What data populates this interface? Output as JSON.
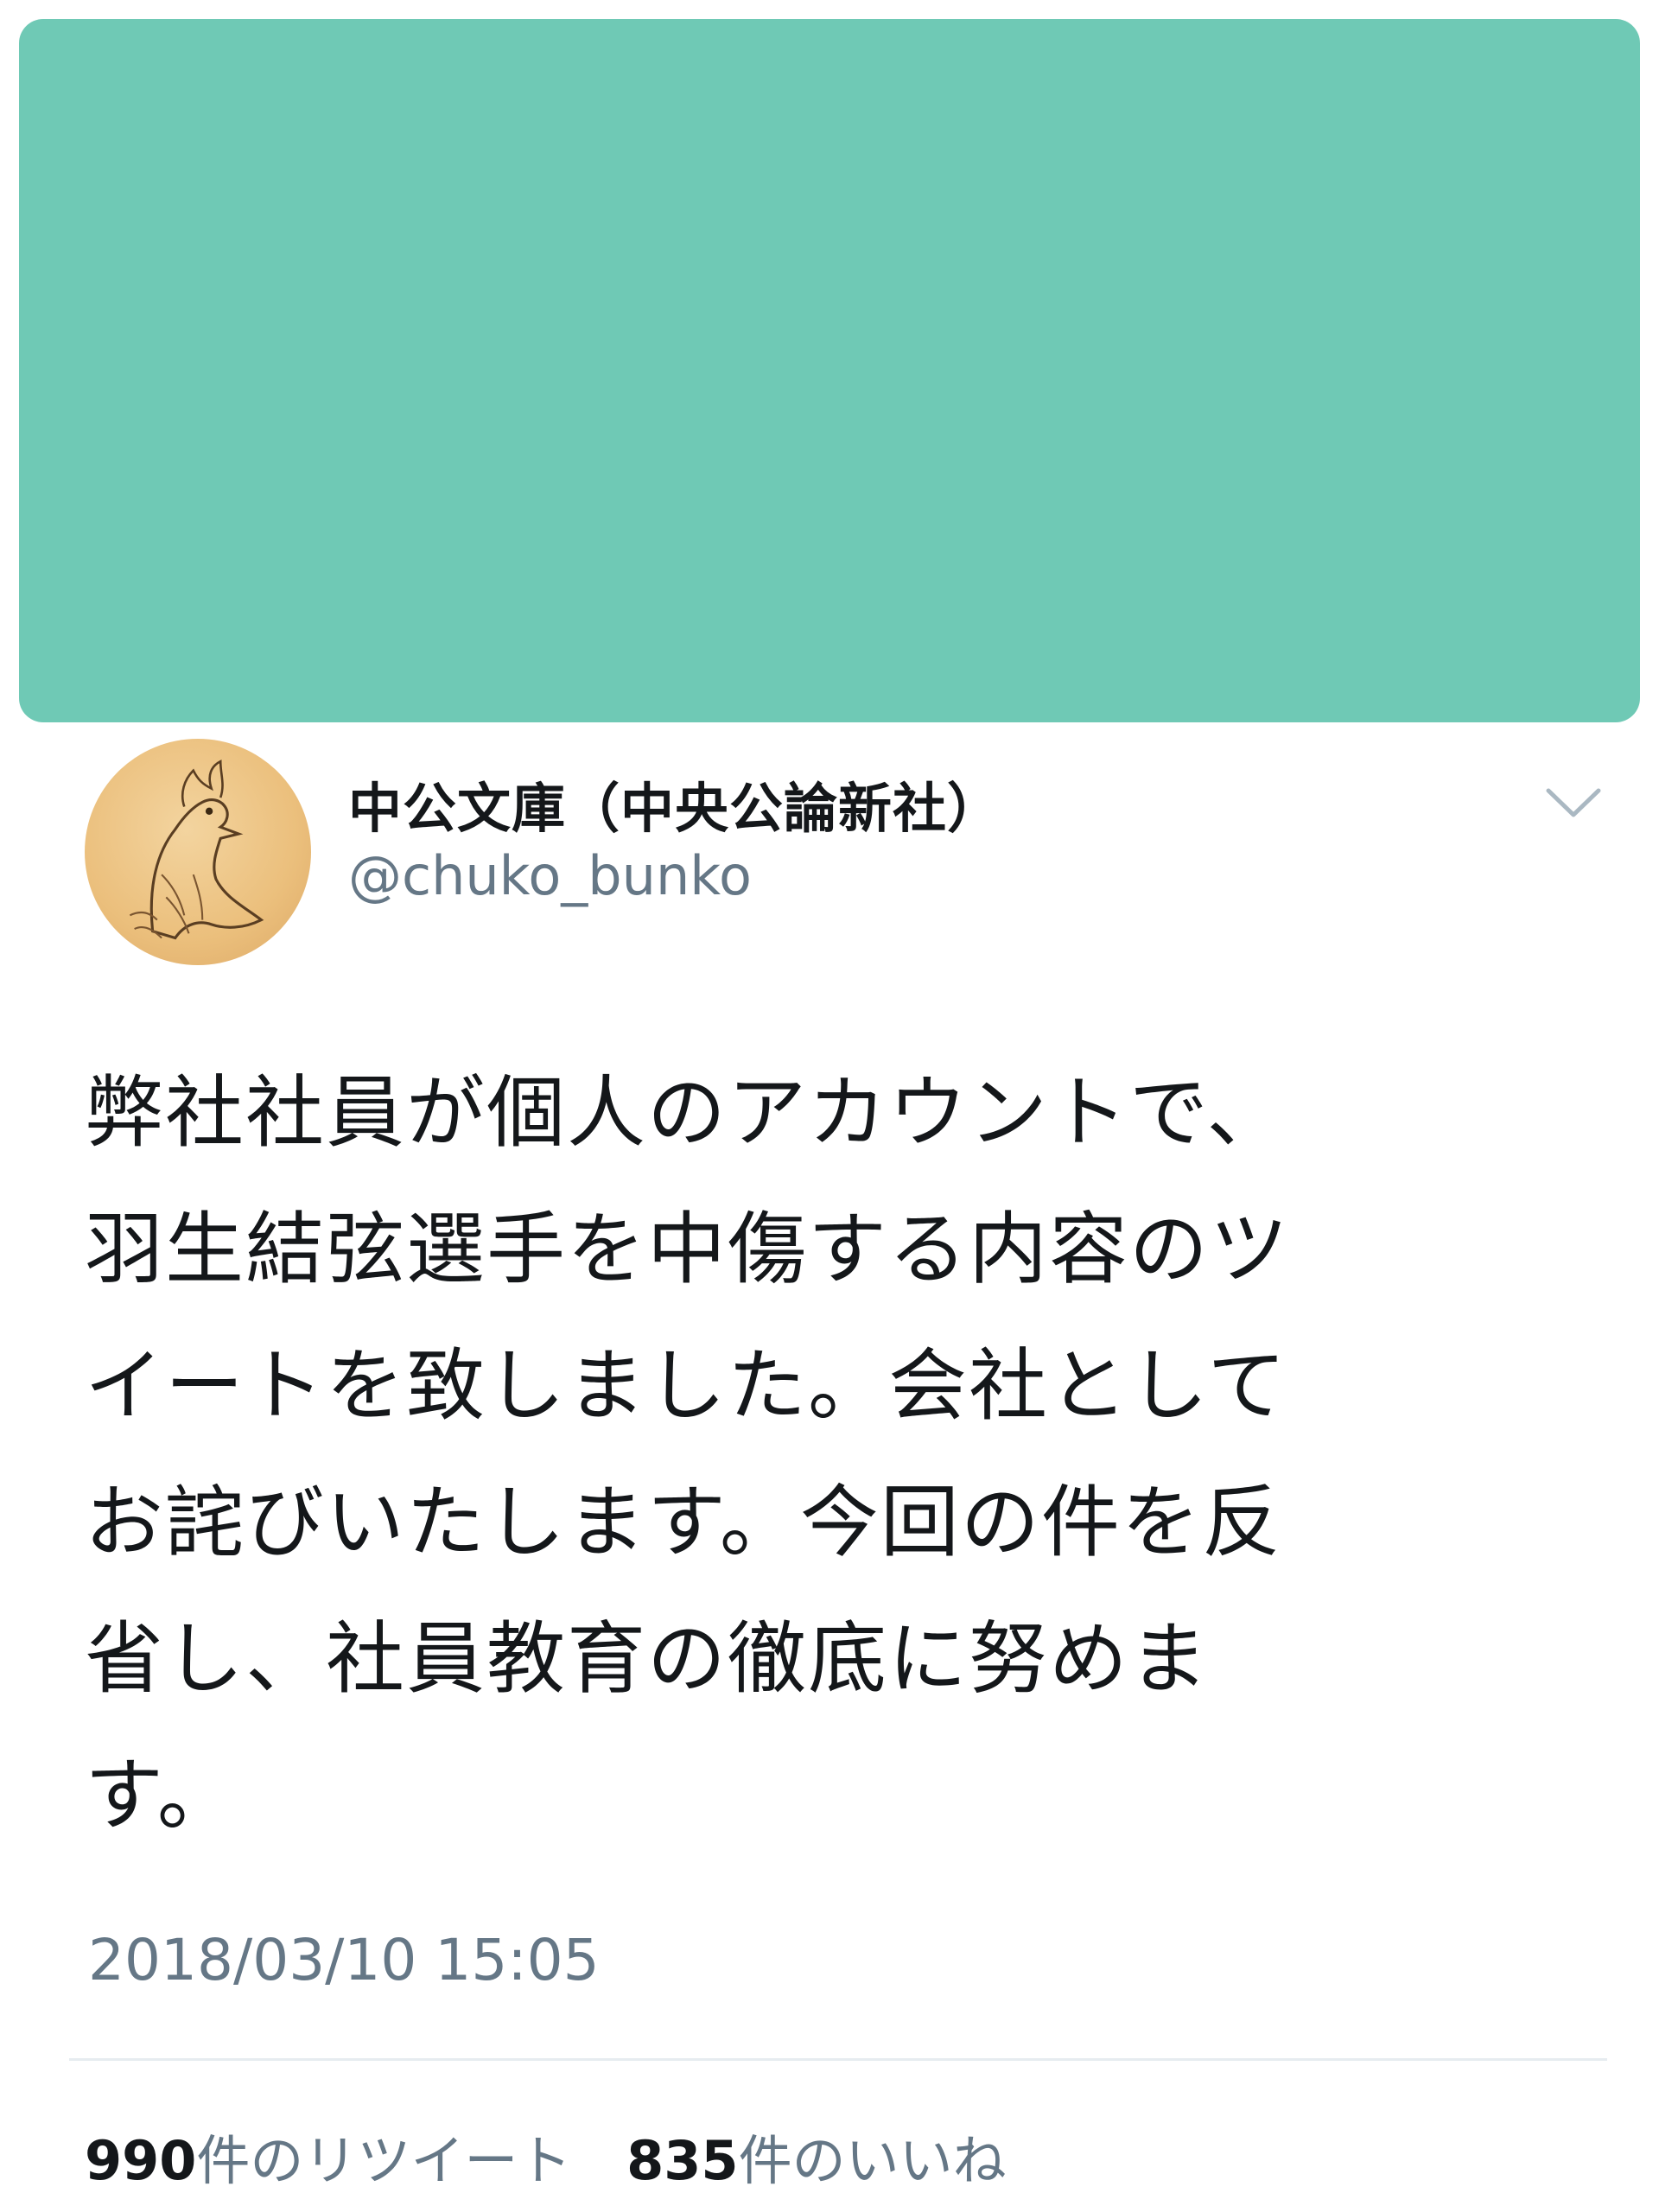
{
  "banner": {
    "color": "#6fc9b5"
  },
  "header": {
    "display_name": "中公文庫（中央公論新社）",
    "handle": "@chuko_bunko",
    "avatar_icon": "bird-portrait-avatar",
    "menu_icon": "chevron-down-icon"
  },
  "tweet": {
    "text": "弊社社員が個人のアカウントで、\n羽生結弦選手を中傷する内容のツ\nイートを致しました。会社として\nお詫びいたします。今回の件を反\n省し、社員教育の徹底に努めま\nす。",
    "timestamp": "2018/03/10 15:05"
  },
  "stats": {
    "retweets": {
      "count": "990",
      "label": "件のリツイート"
    },
    "likes": {
      "count": "835",
      "label": "件のいいね"
    }
  },
  "colors": {
    "text": "#14171a",
    "secondary": "#657786",
    "divider": "#e6ecf0"
  }
}
